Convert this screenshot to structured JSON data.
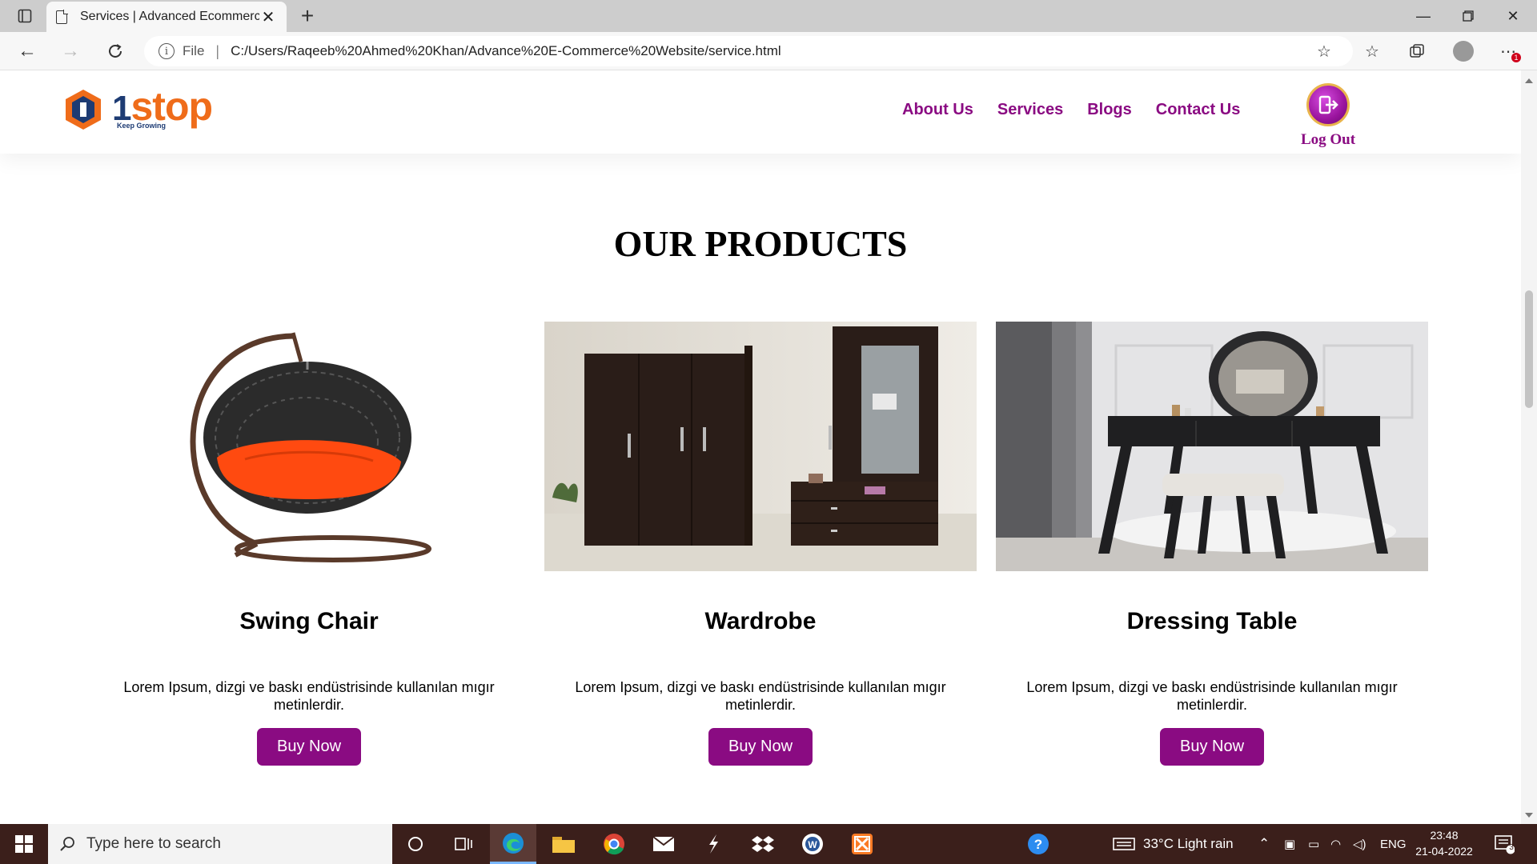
{
  "browser": {
    "tab_title": "Services | Advanced Ecommerce",
    "url_scheme": "File",
    "url": "C:/Users/Raqeeb%20Ahmed%20Khan/Advance%20E-Commerce%20Website/service.html",
    "notification_badge": "1"
  },
  "header": {
    "logo_text": "stop",
    "logo_digit": "1",
    "logo_tagline": "Keep Growing",
    "nav": [
      "About Us",
      "Services",
      "Blogs",
      "Contact Us"
    ],
    "logout_label": "Log Out"
  },
  "main": {
    "section_title": "OUR PRODUCTS",
    "products": [
      {
        "name": "Swing Chair",
        "description": "Lorem Ipsum, dizgi ve baskı endüstrisinde kullanılan mıgır metinlerdir.",
        "button": "Buy Now"
      },
      {
        "name": "Wardrobe",
        "description": "Lorem Ipsum, dizgi ve baskı endüstrisinde kullanılan mıgır metinlerdir.",
        "button": "Buy Now"
      },
      {
        "name": "Dressing Table",
        "description": "Lorem Ipsum, dizgi ve baskı endüstrisinde kullanılan mıgır metinlerdir.",
        "button": "Buy Now"
      }
    ]
  },
  "taskbar": {
    "search_placeholder": "Type here to search",
    "weather": "33°C  Light rain",
    "language": "ENG",
    "time": "23:48",
    "date": "21-04-2022",
    "notifications": "3"
  },
  "colors": {
    "accent": "#8a0b82",
    "logo_orange": "#ef6c1a",
    "logo_navy": "#1d3b73",
    "taskbar": "#3b1f1b"
  }
}
